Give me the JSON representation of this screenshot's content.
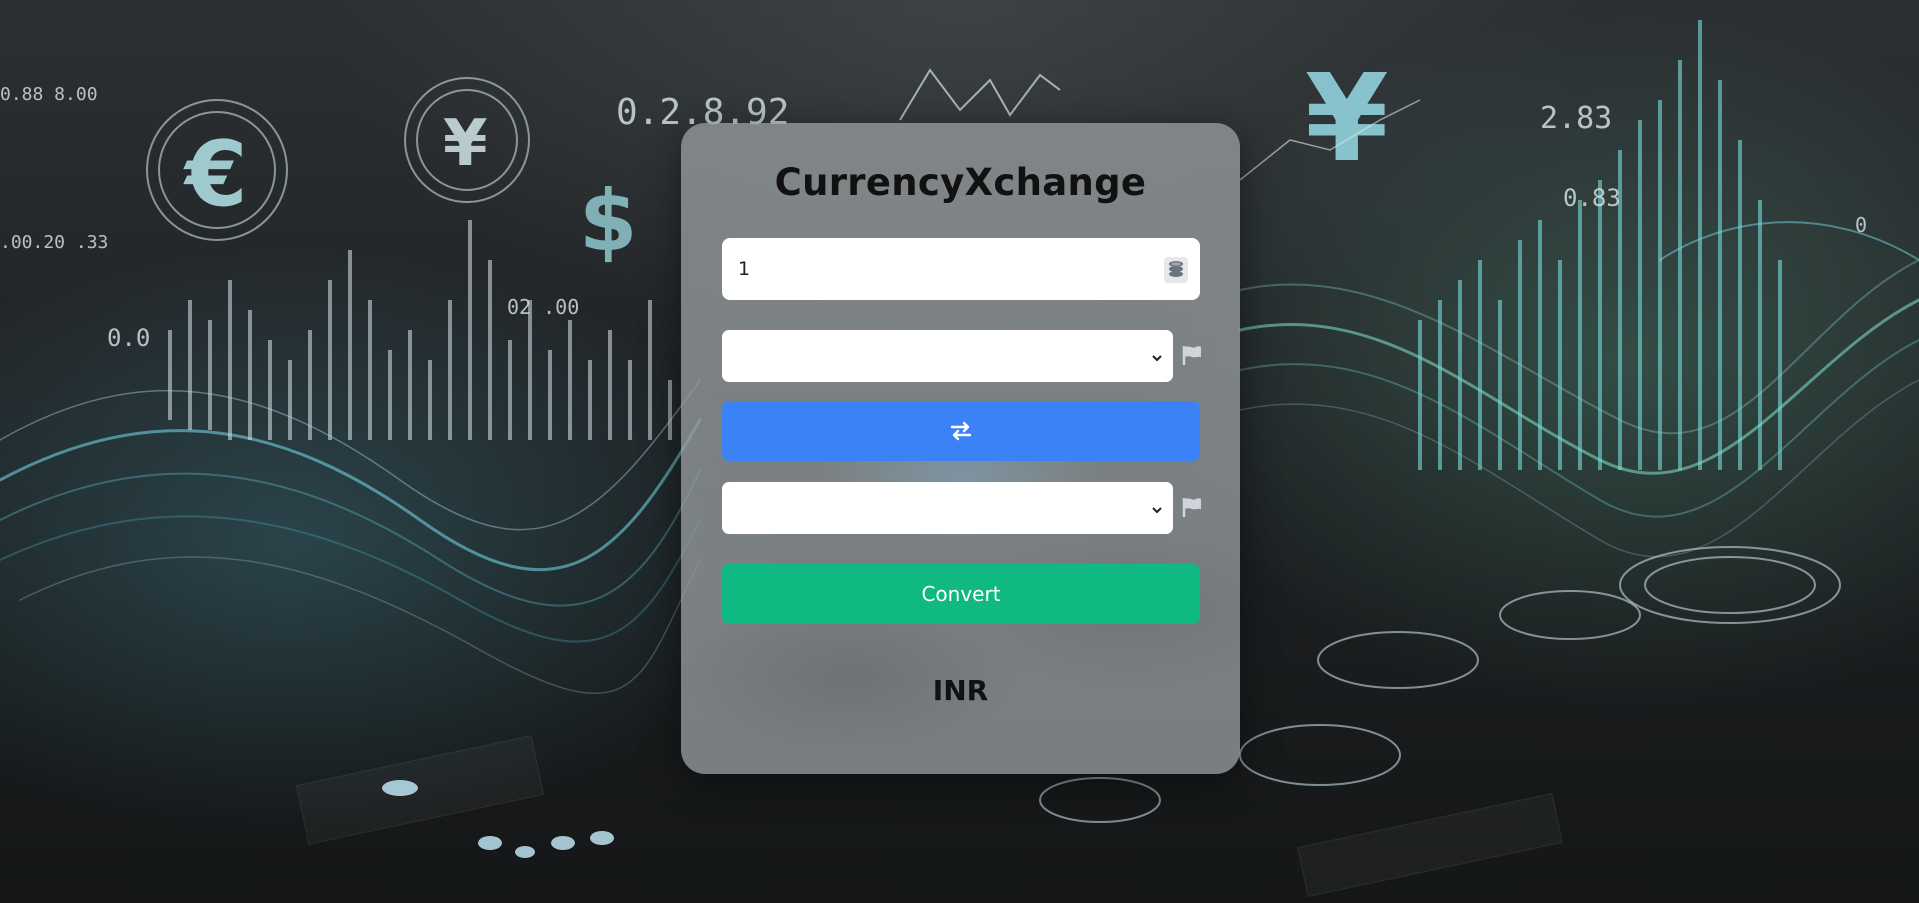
{
  "app": {
    "title": "CurrencyXchange"
  },
  "amount": {
    "value": "1",
    "icon": "coins-icon"
  },
  "from_currency": {
    "selected": "",
    "flag_icon": "flag-icon"
  },
  "swap": {
    "icon": "swap-arrows-icon"
  },
  "to_currency": {
    "selected": "",
    "flag_icon": "flag-icon"
  },
  "convert": {
    "label": "Convert"
  },
  "result": {
    "text": "INR"
  },
  "background": {
    "texts": [
      "0.2.8.92",
      "2.83",
      "0.83",
      "0.0",
      "02 .00",
      ".00.20 .33",
      "0",
      "$"
    ]
  },
  "colors": {
    "swap_button": "#3b82f6",
    "convert_button": "#10b981",
    "card": "#96999e"
  }
}
